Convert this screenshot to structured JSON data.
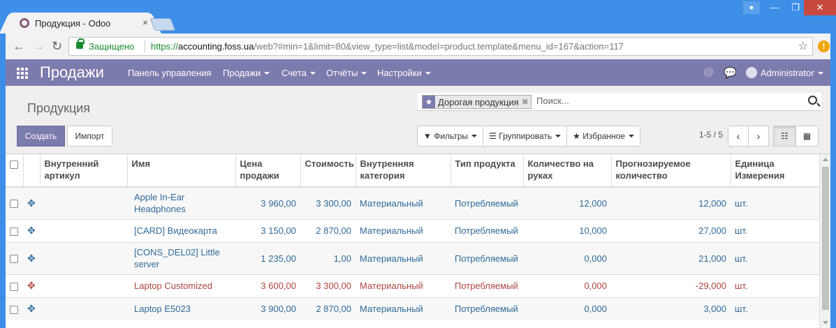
{
  "browser": {
    "tab_title": "Продукция - Odoo",
    "tab_close": "×",
    "secure_label": "Защищено",
    "url_proto": "https://",
    "url_host": "accounting.foss.ua",
    "url_rest": "/web?#min=1&limit=80&view_type=list&model=product.template&menu_id=167&action=117",
    "minimize": "—",
    "maximize": "❐",
    "close": "✕"
  },
  "navbar": {
    "brand": "Продажи",
    "menus": [
      "Панель управления",
      "Продажи",
      "Счета",
      "Отчёты",
      "Настройки"
    ],
    "user": "Administrator",
    "color": "#7c7bad"
  },
  "control_panel": {
    "breadcrumb": "Продукция",
    "facet_value": "Дорогая продукция",
    "search_placeholder": "Поиск...",
    "create_label": "Создать",
    "import_label": "Импорт",
    "filters_label": "Фильтры",
    "groupby_label": "Группировать",
    "favorites_label": "Избранное",
    "pager": "1-5 / 5"
  },
  "table": {
    "columns": [
      "Внутренний артикул",
      "Имя",
      "Цена продажи",
      "Стоимость",
      "Внутренняя категория",
      "Тип продукта",
      "Количество на руках",
      "Прогнозируемое количество",
      "Единица Измерения"
    ],
    "rows": [
      {
        "name": "Apple In-Ear Headphones",
        "price": "3 960,00",
        "cost": "3 300,00",
        "category": "Материальный",
        "type": "Потребляемый",
        "on_hand": "12,000",
        "forecast": "12,000",
        "uom": "шт."
      },
      {
        "name": "[CARD] Видеокарта",
        "price": "3 150,00",
        "cost": "2 870,00",
        "category": "Материальный",
        "type": "Потребляемый",
        "on_hand": "10,000",
        "forecast": "27,000",
        "uom": "шт."
      },
      {
        "name": "[CONS_DEL02] Little server",
        "price": "1 235,00",
        "cost": "1,00",
        "category": "Материальный",
        "type": "Потребляемый",
        "on_hand": "0,000",
        "forecast": "21,000",
        "uom": "шт."
      },
      {
        "name": "Laptop Customized",
        "price": "3 600,00",
        "cost": "3 300,00",
        "category": "Материальный",
        "type": "Потребляемый",
        "on_hand": "0,000",
        "forecast": "-29,000",
        "uom": "шт."
      },
      {
        "name": "Laptop E5023",
        "price": "3 900,00",
        "cost": "2 870,00",
        "category": "Материальный",
        "type": "Потребляемый",
        "on_hand": "0,000",
        "forecast": "3,000",
        "uom": "шт."
      }
    ]
  }
}
